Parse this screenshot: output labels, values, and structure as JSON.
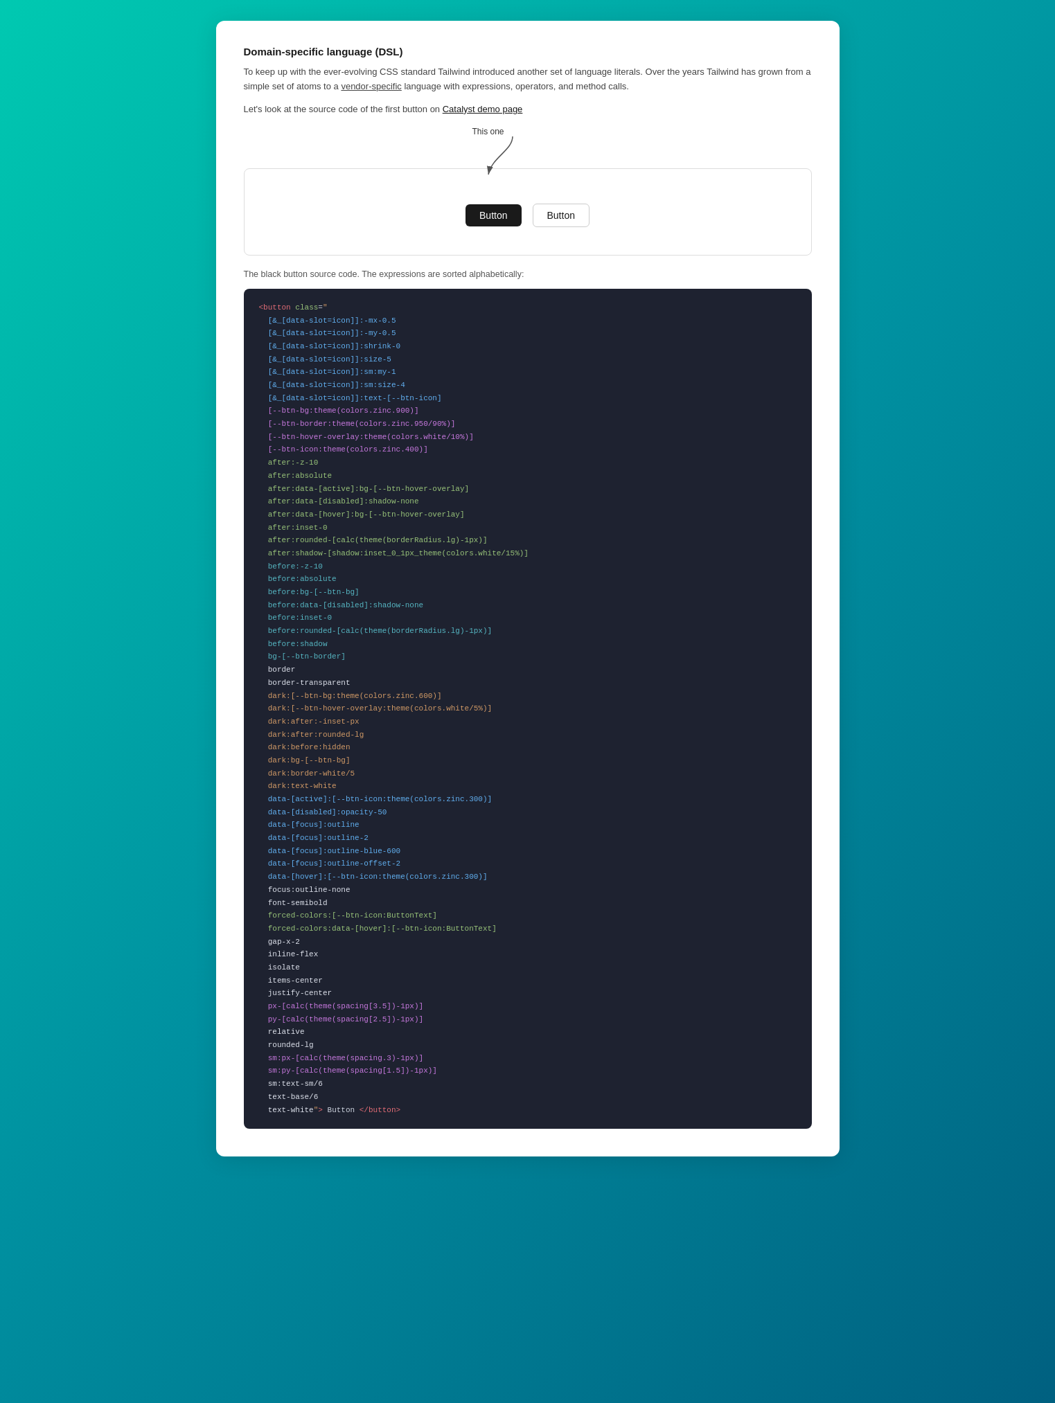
{
  "page": {
    "title": "Domain-specific language (DSL)",
    "description1": "To keep up with the ever-evolving CSS standard Tailwind introduced another set of language literals. Over the years Tailwind has grown from a simple set of atoms to a vendor-specific language with expressions, operators, and method calls.",
    "intro_link_text": "Let's look at the source code of the first button on ",
    "catalyst_link": "Catalyst demo page",
    "annotation_label": "This one",
    "btn_dark_label": "Button",
    "btn_light_label": "Button",
    "code_desc": "The black button source code. The expressions are sorted alphabetically:",
    "code_open_tag": "<button class=\"",
    "code_close_tag": "text-white\"> Button </button>",
    "code_lines": [
      "[&amp;_[data-slot=icon]]:-mx-0.5",
      "[&amp;_[data-slot=icon]]:-my-0.5",
      "[&amp;_[data-slot=icon]]:shrink-0",
      "[&amp;_[data-slot=icon]]:size-5",
      "[&amp;_[data-slot=icon]]:sm:my-1",
      "[&amp;_[data-slot=icon]]:sm:size-4",
      "[&amp;_[data-slot=icon]]:text-[--btn-icon]",
      "[--btn-bg:theme(colors.zinc.900)]",
      "[--btn-border:theme(colors.zinc.950/90%)]",
      "[--btn-hover-overlay:theme(colors.white/10%)]",
      "[--btn-icon:theme(colors.zinc.400)]",
      "after:-z-10",
      "after:absolute",
      "after:data-[active]:bg-[--btn-hover-overlay]",
      "after:data-[disabled]:shadow-none",
      "after:data-[hover]:bg-[--btn-hover-overlay]",
      "after:inset-0",
      "after:rounded-[calc(theme(borderRadius.lg)-1px)]",
      "after:shadow-[shadow:inset_0_1px_theme(colors.white/15%)]",
      "before:-z-10",
      "before:absolute",
      "before:bg-[--btn-bg]",
      "before:data-[disabled]:shadow-none",
      "before:inset-0",
      "before:rounded-[calc(theme(borderRadius.lg)-1px)]",
      "before:shadow",
      "bg-[--btn-border]",
      "border",
      "border-transparent",
      "dark:[--btn-bg:theme(colors.zinc.600)]",
      "dark:[--btn-hover-overlay:theme(colors.white/5%)]",
      "dark:after:-inset-px",
      "dark:after:rounded-lg",
      "dark:before:hidden",
      "dark:bg-[--btn-bg]",
      "dark:border-white/5",
      "dark:text-white",
      "data-[active]:[--btn-icon:theme(colors.zinc.300)]",
      "data-[disabled]:opacity-50",
      "data-[focus]:outline",
      "data-[focus]:outline-2",
      "data-[focus]:outline-blue-600",
      "data-[focus]:outline-offset-2",
      "data-[hover]:[--btn-icon:theme(colors.zinc.300)]",
      "focus:outline-none",
      "font-semibold",
      "forced-colors:[--btn-icon:ButtonText]",
      "forced-colors:data-[hover]:[--btn-icon:ButtonText]",
      "gap-x-2",
      "inline-flex",
      "isolate",
      "items-center",
      "justify-center",
      "px-[calc(theme(spacing[3.5])-1px)]",
      "py-[calc(theme(spacing[2.5])-1px)]",
      "relative",
      "rounded-lg",
      "sm:px-[calc(theme(spacing.3)-1px)]",
      "sm:py-[calc(theme(spacing[1.5])-1px)]",
      "sm:text-sm/6",
      "text-base/6",
      "text-white"
    ]
  }
}
